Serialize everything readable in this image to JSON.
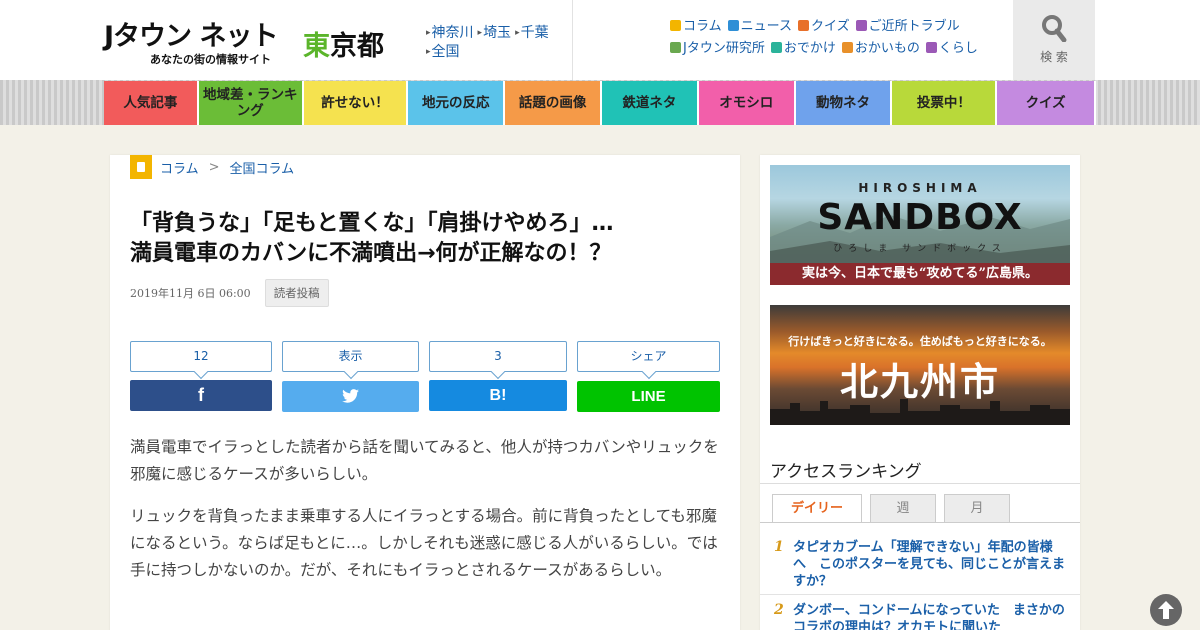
{
  "header": {
    "logo_mark": "Jタウン ネット",
    "logo_sub": "あなたの街の情報サイト",
    "pref_first": "東",
    "pref_rest": "京都",
    "pref_links": [
      "神奈川",
      "埼玉",
      "千葉",
      "全国"
    ],
    "categories": [
      {
        "label": "コラム",
        "icon": "column-icon",
        "color": "#f3b500"
      },
      {
        "label": "ニュース",
        "icon": "pencil-icon",
        "color": "#2f8fd6"
      },
      {
        "label": "クイズ",
        "icon": "quiz-icon",
        "color": "#e8702a"
      },
      {
        "label": "ご近所トラブル",
        "icon": "house-icon",
        "color": "#9b59b6"
      },
      {
        "label": "Jタウン研究所",
        "icon": "flask-icon",
        "color": "#6aa84f"
      },
      {
        "label": "おでかけ",
        "icon": "car-icon",
        "color": "#2bb39a"
      },
      {
        "label": "おかいもの",
        "icon": "bag-icon",
        "color": "#e8902a"
      },
      {
        "label": "くらし",
        "icon": "home-icon",
        "color": "#9b59b6"
      }
    ],
    "search_label": "検 索"
  },
  "nav": [
    {
      "label": "人気記事",
      "color": "#f25b5b"
    },
    {
      "label": "地域差・ランキング",
      "color": "#6bbd37"
    },
    {
      "label": "許せない！",
      "color": "#f5e24f"
    },
    {
      "label": "地元の反応",
      "color": "#5bc3ea"
    },
    {
      "label": "話題の画像",
      "color": "#f59a48"
    },
    {
      "label": "鉄道ネタ",
      "color": "#20c2b6"
    },
    {
      "label": "オモシロ",
      "color": "#f25faa"
    },
    {
      "label": "動物ネタ",
      "color": "#6fa2ec"
    },
    {
      "label": "投票中！",
      "color": "#b8d93a"
    },
    {
      "label": "クイズ",
      "color": "#c48ae0"
    }
  ],
  "article": {
    "breadcrumb": {
      "section": "コラム",
      "separator": ">",
      "sub": "全国コラム"
    },
    "title_line1": "「背負うな」「足もと置くな」「肩掛けやめろ」…",
    "title_line2": "満員電車のカバンに不満噴出→何が正解なの！？",
    "date": "2019年11月 6日 06:00",
    "tag": "読者投稿",
    "counts": [
      "12",
      "表示",
      "3",
      "シェア"
    ],
    "share": {
      "facebook": "f",
      "twitter": "twitter",
      "hatena": "B!",
      "line": "LINE"
    },
    "para1": "満員電車でイラっとした読者から話を聞いてみると、他人が持つカバンやリュックを邪魔に感じるケースが多いらしい。",
    "para2": "リュックを背負ったまま乗車する人にイラっとする場合。前に背負ったとしても邪魔になるという。ならば足もとに…。しかしそれも迷惑に感じる人がいるらしい。では手に持つしかないのか。だが、それにもイラっとされるケースがあるらしい。"
  },
  "sidebar": {
    "banner1": {
      "top": "HIROSHIMA",
      "main": "SANDBOX",
      "kana": "ひろしま サンドボックス",
      "bottom": "実は今、日本で最も“攻めてる”広島県。",
      "colors": {
        "band": "#8b2a2e"
      }
    },
    "banner2": {
      "top": "行けばきっと好きになる。住めばもっと好きになる。",
      "main": "北九州市"
    },
    "ranking": {
      "title": "アクセスランキング",
      "tabs": [
        "デイリー",
        "週",
        "月"
      ],
      "active_tab": "デイリー",
      "items": [
        {
          "rank": "1",
          "text": "タピオカブーム「理解できない」年配の皆様へ　このポスターを見ても、同じことが言えますか？"
        },
        {
          "rank": "2",
          "text": "ダンボー、コンドームになっていた　まさかのコラボの理由は？オカモトに聞いた"
        }
      ]
    }
  },
  "colors": {
    "link": "#1a5fa8",
    "facebook": "#2d4f8a",
    "twitter": "#55acee",
    "hatena": "#158ae0",
    "line": "#00c300",
    "rank_accent": "#e6641e"
  }
}
